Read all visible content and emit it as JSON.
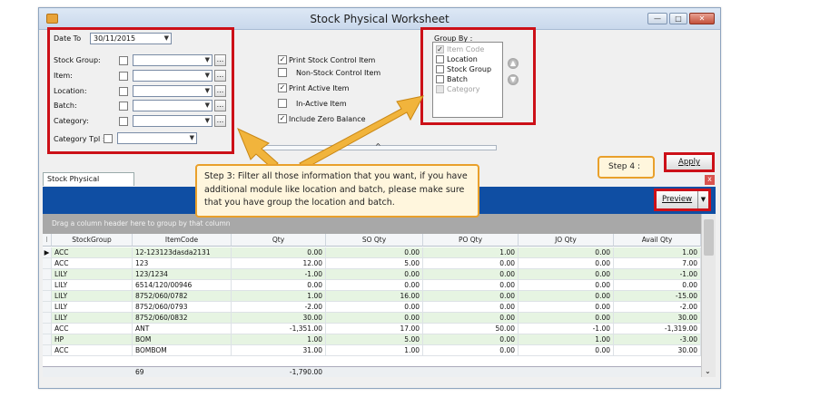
{
  "window": {
    "title": "Stock Physical Worksheet",
    "minimize": "—",
    "restore": "□",
    "close": "✕"
  },
  "filters": {
    "date_to_label": "Date To",
    "date_to_value": "30/11/2015",
    "rows": [
      {
        "label": "Stock Group:"
      },
      {
        "label": "Item:"
      },
      {
        "label": "Location:"
      },
      {
        "label": "Batch:"
      },
      {
        "label": "Category:"
      }
    ],
    "category_tpl_label": "Category Tpl :",
    "ellipsis": "..."
  },
  "options": [
    {
      "label": "Print Stock Control Item",
      "checked": true
    },
    {
      "label": "Non-Stock Control Item",
      "checked": false
    },
    {
      "label": "Print Active Item",
      "checked": true
    },
    {
      "label": "In-Active Item",
      "checked": false
    },
    {
      "label": "Include Zero Balance",
      "checked": true
    }
  ],
  "group_by": {
    "label": "Group By :",
    "items": [
      {
        "label": "Item Code",
        "checked": true,
        "disabled": true
      },
      {
        "label": "Location",
        "checked": false,
        "disabled": false
      },
      {
        "label": "Stock Group",
        "checked": false,
        "disabled": false
      },
      {
        "label": "Batch",
        "checked": false,
        "disabled": false
      },
      {
        "label": "Category",
        "checked": false,
        "disabled": true
      }
    ]
  },
  "tab_label": "Stock Physical Worksheet",
  "step3_text": "Step 3: Filter all those information that you want, if you have additional module like location and batch, please make sure that you have group the location and batch.",
  "step4_text": "Step 4 :",
  "apply_label": "Apply",
  "preview_label": "Preview",
  "group_hint": "Drag a column header here to group by that column",
  "grid": {
    "columns": [
      "StockGroup",
      "ItemCode",
      "Qty",
      "SO Qty",
      "PO Qty",
      "JO Qty",
      "Avail Qty"
    ],
    "rows": [
      [
        "ACC",
        "12-123123dasda2131",
        "0.00",
        "0.00",
        "1.00",
        "0.00",
        "1.00"
      ],
      [
        "ACC",
        "123",
        "12.00",
        "5.00",
        "0.00",
        "0.00",
        "7.00"
      ],
      [
        "LILY",
        "123/1234",
        "-1.00",
        "0.00",
        "0.00",
        "0.00",
        "-1.00"
      ],
      [
        "LILY",
        "6514/120/00946",
        "0.00",
        "0.00",
        "0.00",
        "0.00",
        "0.00"
      ],
      [
        "LILY",
        "8752/060/0782",
        "1.00",
        "16.00",
        "0.00",
        "0.00",
        "-15.00"
      ],
      [
        "LILY",
        "8752/060/0793",
        "-2.00",
        "0.00",
        "0.00",
        "0.00",
        "-2.00"
      ],
      [
        "LILY",
        "8752/060/0832",
        "30.00",
        "0.00",
        "0.00",
        "0.00",
        "30.00"
      ],
      [
        "ACC",
        "ANT",
        "-1,351.00",
        "17.00",
        "50.00",
        "-1.00",
        "-1,319.00"
      ],
      [
        "HP",
        "BOM",
        "1.00",
        "5.00",
        "0.00",
        "1.00",
        "-3.00"
      ],
      [
        "ACC",
        "BOMBOM",
        "31.00",
        "1.00",
        "0.00",
        "0.00",
        "30.00"
      ]
    ],
    "footer_count": "69",
    "footer_qty": "-1,790.00"
  }
}
